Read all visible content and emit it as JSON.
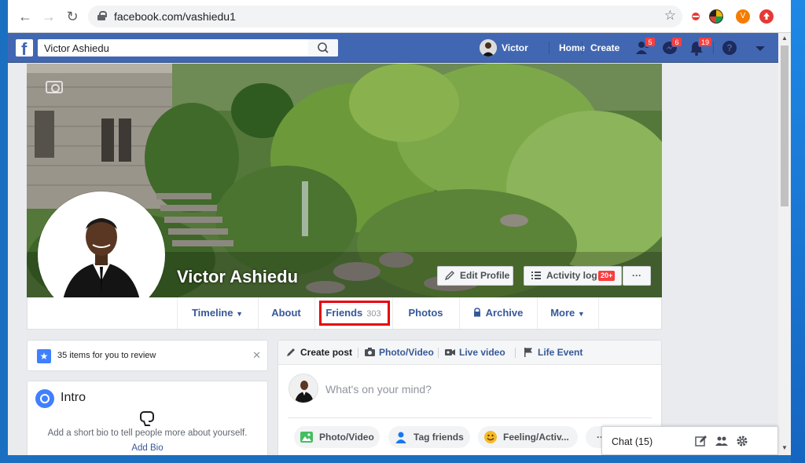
{
  "browser": {
    "url": "facebook.com/vashiedu1"
  },
  "header": {
    "search_value": "Victor Ashiedu",
    "user_name": "Victor",
    "home_label": "Home",
    "create_label": "Create",
    "friend_requests_count": "5",
    "messages_count": "6",
    "notifications_count": "19",
    "colors": {
      "bar": "#4267b2",
      "badge": "#fa3e3e"
    }
  },
  "profile": {
    "name": "Victor Ashiedu",
    "edit_profile_label": "Edit Profile",
    "activity_log_label": "Activity log",
    "activity_log_badge": "20+",
    "more_dots": "···"
  },
  "tabs": [
    {
      "label": "Timeline",
      "caret": true
    },
    {
      "label": "About"
    },
    {
      "label": "Friends",
      "count": "303",
      "highlighted": true
    },
    {
      "label": "Photos"
    },
    {
      "label": "Archive",
      "icon": "lock-icon"
    },
    {
      "label": "More",
      "caret": true
    }
  ],
  "review": {
    "text": "35 items for you to review"
  },
  "intro": {
    "title": "Intro",
    "description": "Add a short bio to tell people more about yourself.",
    "link": "Add Bio"
  },
  "composer": {
    "tabs": [
      "Create post",
      "Photo/Video",
      "Live video",
      "Life Event"
    ],
    "placeholder": "What's on your mind?",
    "actions": [
      "Photo/Video",
      "Tag friends",
      "Feeling/Activ...",
      "···"
    ]
  },
  "chat": {
    "label": "Chat (15)"
  }
}
